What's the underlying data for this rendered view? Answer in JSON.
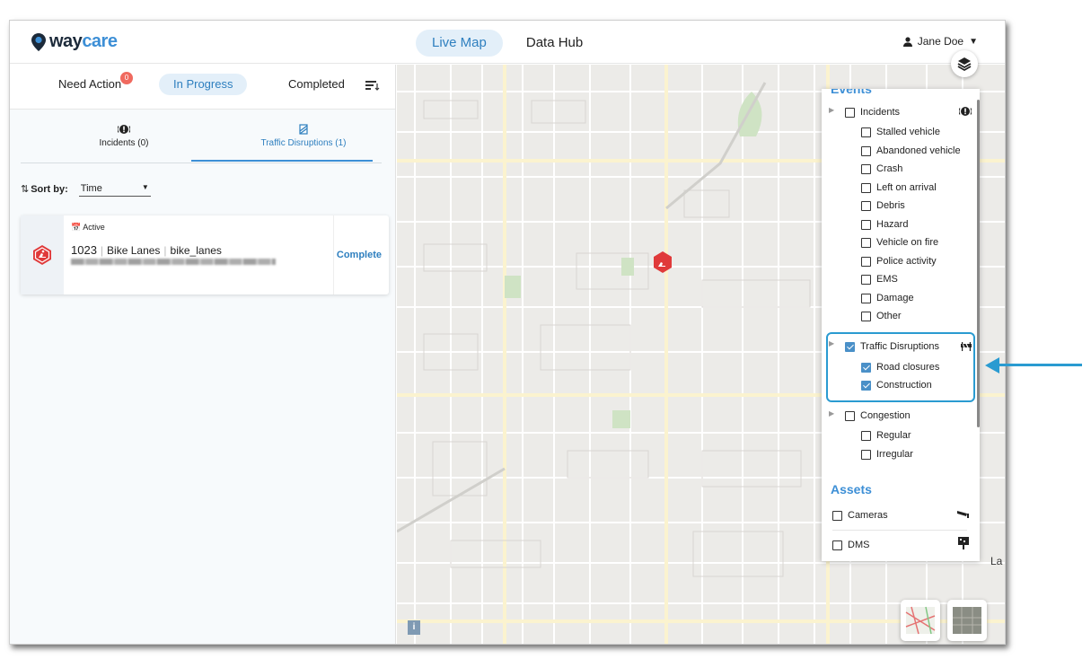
{
  "app": {
    "logo_way": "way",
    "logo_care": "care"
  },
  "nav": {
    "live_map": "Live Map",
    "data_hub": "Data Hub"
  },
  "user": {
    "name": "Jane Doe"
  },
  "status_tabs": {
    "need_action": "Need Action",
    "need_action_count": "0",
    "in_progress": "In Progress",
    "completed": "Completed"
  },
  "type_tabs": {
    "incidents": "Incidents (0)",
    "traffic": "Traffic Disruptions (1)"
  },
  "sort": {
    "label": "Sort by:",
    "value": "Time"
  },
  "card": {
    "status": "Active",
    "id": "1023",
    "type": "Bike Lanes",
    "subtype": "bike_lanes",
    "complete": "Complete"
  },
  "layers": {
    "events_header": "Events",
    "incidents": {
      "label": "Incidents",
      "items": [
        "Stalled vehicle",
        "Abandoned vehicle",
        "Crash",
        "Left on arrival",
        "Debris",
        "Hazard",
        "Vehicle on fire",
        "Police activity",
        "EMS",
        "Damage",
        "Other"
      ]
    },
    "traffic": {
      "label": "Traffic Disruptions",
      "items": [
        "Road closures",
        "Construction"
      ]
    },
    "congestion": {
      "label": "Congestion",
      "items": [
        "Regular",
        "Irregular"
      ]
    },
    "assets_header": "Assets",
    "assets": [
      "Cameras",
      "DMS"
    ]
  },
  "map_label": "La",
  "info": "i",
  "colors": {
    "accent": "#3d8fd6",
    "highlight": "#2a9bd1",
    "alert": "#e03a3a"
  }
}
